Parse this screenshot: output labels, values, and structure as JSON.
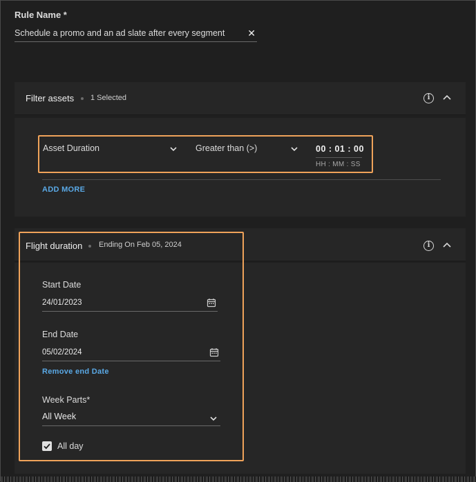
{
  "rule": {
    "label": "Rule Name *",
    "value": "Schedule a promo and an ad slate after every segment",
    "clear_icon": "close-icon"
  },
  "filter_panel": {
    "title": "Filter assets",
    "subtitle": "1 Selected",
    "row": {
      "field": "Asset Duration",
      "operator": "Greater than (>)",
      "time_value": "00 : 01 : 00",
      "time_hint": "HH : MM : SS"
    },
    "add_more": "ADD MORE"
  },
  "flight_panel": {
    "title": "Flight duration",
    "subtitle": "Ending On Feb 05, 2024",
    "start_label": "Start Date",
    "start_value": "24/01/2023",
    "end_label": "End Date",
    "end_value": "05/02/2024",
    "remove_end": "Remove end Date",
    "week_label": "Week Parts*",
    "week_value": "All Week",
    "all_day_label": "All day",
    "all_day_checked": true
  },
  "colors": {
    "background": "#1f1f1f",
    "panel": "#262626",
    "highlight": "#f0a35a",
    "link": "#5aa9e6"
  }
}
